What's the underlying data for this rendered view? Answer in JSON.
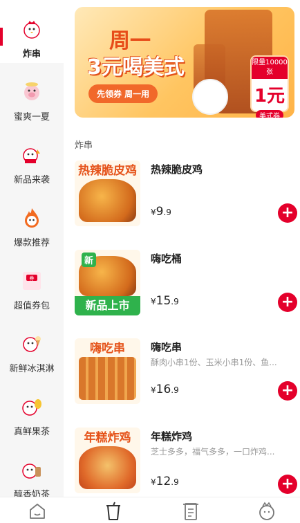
{
  "sidebar": {
    "items": [
      {
        "label": "炸串",
        "icon": "chicken-mascot-icon"
      },
      {
        "label": "蜜爽一夏",
        "icon": "pig-mascot-icon"
      },
      {
        "label": "新品来袭",
        "icon": "chicken-mascot-icon"
      },
      {
        "label": "爆款推荐",
        "icon": "fire-mascot-icon"
      },
      {
        "label": "超值券包",
        "icon": "coupon-icon"
      },
      {
        "label": "新鲜冰淇淋",
        "icon": "ice-cream-mascot-icon"
      },
      {
        "label": "真鲜果茶",
        "icon": "fruit-tea-mascot-icon"
      },
      {
        "label": "醇香奶茶",
        "icon": "milk-tea-mascot-icon"
      }
    ]
  },
  "banner": {
    "line1": "周一",
    "line2": "3元喝美式",
    "pill": "先领券 周一用",
    "coupon_top": "限量10000张",
    "coupon_value": "1元",
    "coupon_bottom": "美式券"
  },
  "section_title": "炸串",
  "products": [
    {
      "name": "热辣脆皮鸡",
      "desc": "",
      "img_label": "热辣脆皮鸡",
      "price_int": "9",
      "price_dec": ".9",
      "currency": "¥"
    },
    {
      "name": "嗨吃桶",
      "desc": "",
      "img_label": "新品上市",
      "img_tag": "新",
      "price_int": "15",
      "price_dec": ".9",
      "currency": "¥"
    },
    {
      "name": "嗨吃串",
      "desc": "酥肉小串1份、玉米小串1份、鱼...",
      "img_label": "嗨吃串",
      "price_int": "16",
      "price_dec": ".9",
      "currency": "¥"
    },
    {
      "name": "年糕炸鸡",
      "desc": "芝士多多，福气多多，一口炸鸡...",
      "img_label": "年糕炸鸡",
      "price_int": "12",
      "price_dec": ".9",
      "currency": "¥"
    }
  ],
  "tabs": [
    {
      "icon": "home-icon"
    },
    {
      "icon": "cup-icon"
    },
    {
      "icon": "order-list-icon"
    },
    {
      "icon": "mascot-profile-icon"
    }
  ],
  "colors": {
    "brand": "#e4002b",
    "orange": "#f1682a"
  }
}
